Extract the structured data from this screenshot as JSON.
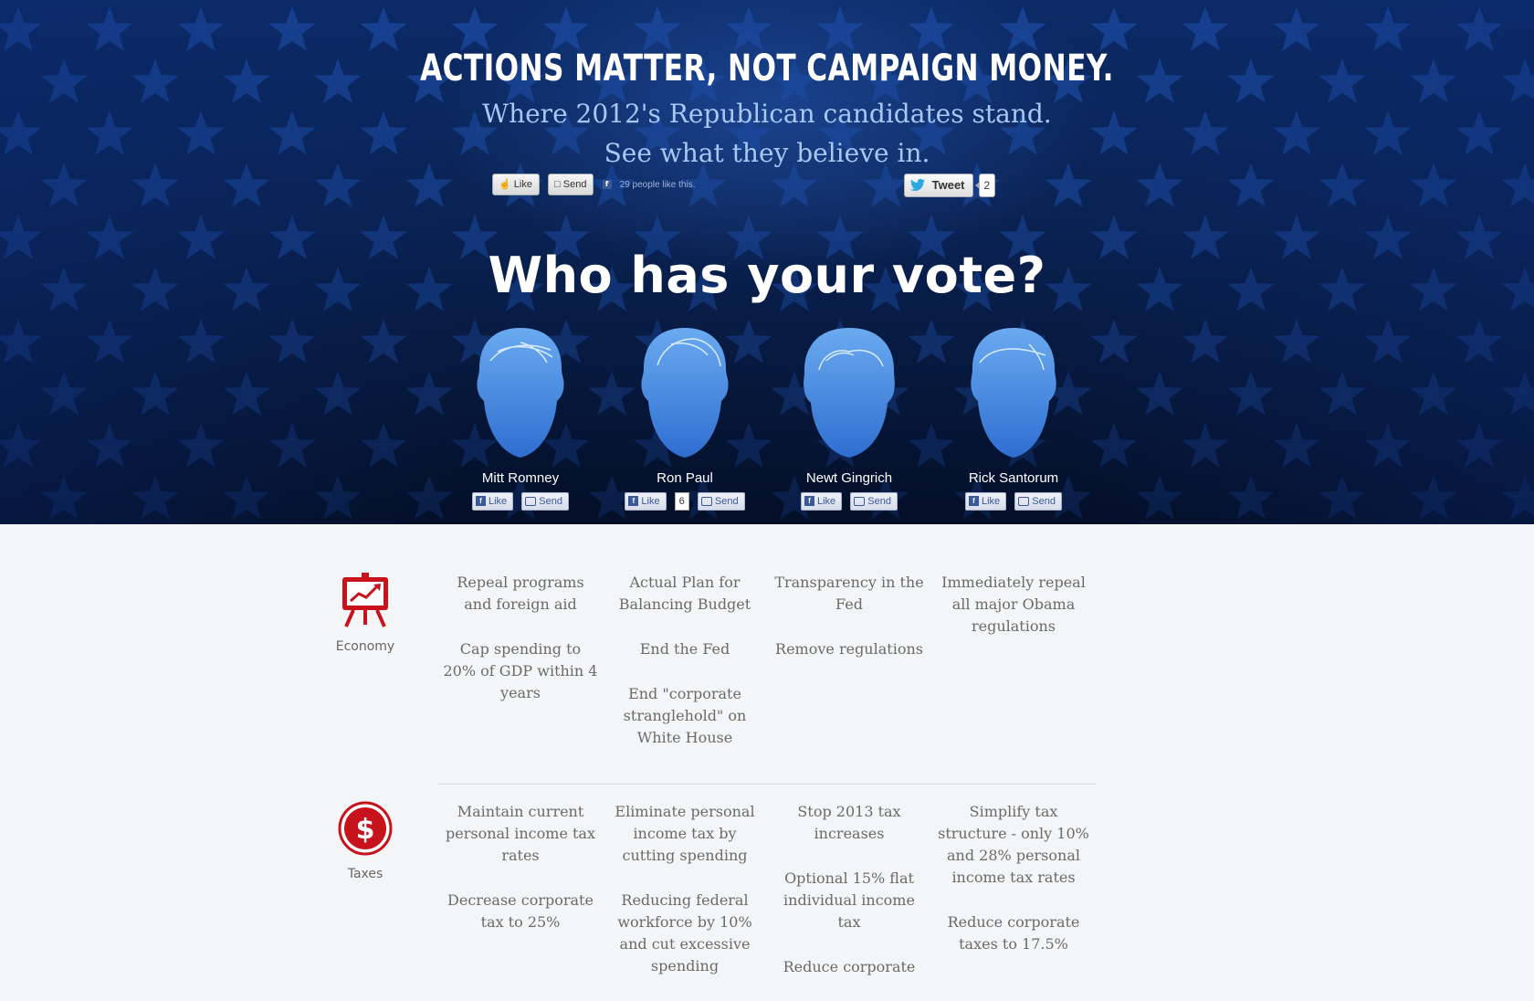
{
  "hero": {
    "headline": "ACTIONS MATTER, NOT CAMPAIGN MONEY.",
    "subtitle_line1": "Where 2012's Republican candidates stand.",
    "subtitle_line2": "See what they believe in.",
    "fb_like_label": "Like",
    "fb_send_label": "Send",
    "fb_count_text": "29 people like this.",
    "tweet_label": "Tweet",
    "tweet_count": "2",
    "vote_title": "Who has your vote?",
    "colors": {
      "background": "#0a2355",
      "subtitle": "#a8c8f4",
      "star": "#1c4aa0"
    }
  },
  "candidates": [
    {
      "name": "Mitt Romney",
      "like_label": "Like",
      "send_label": "Send",
      "like_count": ""
    },
    {
      "name": "Ron Paul",
      "like_label": "Like",
      "send_label": "Send",
      "like_count": "6"
    },
    {
      "name": "Newt Gingrich",
      "like_label": "Like",
      "send_label": "Send",
      "like_count": ""
    },
    {
      "name": "Rick Santorum",
      "like_label": "Like",
      "send_label": "Send",
      "like_count": ""
    }
  ],
  "issues": [
    {
      "label": "Economy",
      "icon": "chart-easel-icon",
      "positions": [
        [
          "Repeal programs and foreign aid",
          "Cap spending to 20% of GDP within 4 years"
        ],
        [
          "Actual Plan for Balancing Budget",
          "End the Fed",
          "End \"corporate stranglehold\" on White House"
        ],
        [
          "Transparency in the Fed",
          "Remove regulations"
        ],
        [
          "Immediately repeal all major Obama regulations"
        ]
      ]
    },
    {
      "label": "Taxes",
      "icon": "dollar-icon",
      "positions": [
        [
          "Maintain current personal income tax rates",
          "Decrease corporate tax to 25%"
        ],
        [
          "Eliminate personal income tax by cutting spending",
          "Reducing federal workforce by 10% and cut excessive spending"
        ],
        [
          "Stop 2013 tax increases",
          "Optional 15% flat individual income tax",
          "Reduce corporate"
        ],
        [
          "Simplify tax structure - only 10% and 28% personal income tax rates",
          "Reduce corporate taxes to 17.5%"
        ]
      ]
    }
  ],
  "accent_color": "#c8121c"
}
